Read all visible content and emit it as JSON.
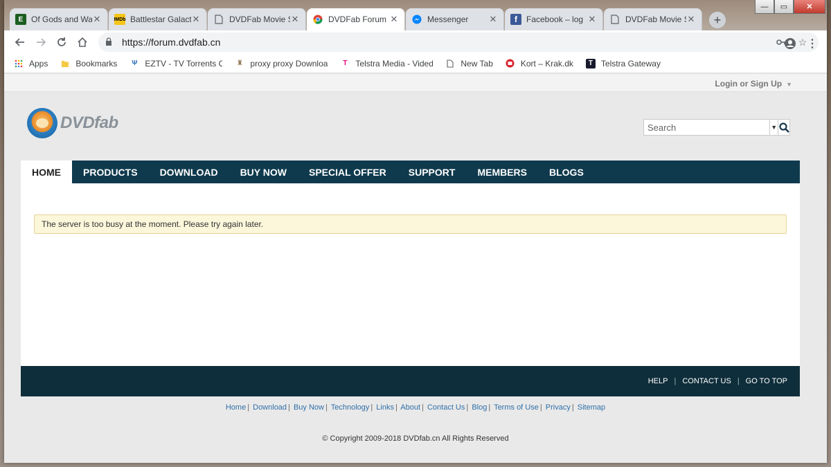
{
  "tabs": [
    {
      "label": "Of Gods and Wa",
      "icon": "book-icon",
      "color": "#1b5e20"
    },
    {
      "label": "Battlestar Galact",
      "icon": "imdb-icon",
      "color": "#f5c518"
    },
    {
      "label": "DVDFab Movie S",
      "icon": "page-icon",
      "color": "#5f6368"
    },
    {
      "label": "DVDFab Forum -",
      "icon": "chrome-icon",
      "color": "#4285f4"
    },
    {
      "label": "Messenger",
      "icon": "messenger-icon",
      "color": "#0084ff"
    },
    {
      "label": "Facebook – log",
      "icon": "facebook-icon",
      "color": "#3b5998"
    },
    {
      "label": "DVDFab Movie S",
      "icon": "page-icon",
      "color": "#5f6368"
    }
  ],
  "address": {
    "url": "https://forum.dvdfab.cn"
  },
  "bookmarks": [
    {
      "label": "Apps",
      "icon": "apps-icon"
    },
    {
      "label": "Bookmarks",
      "icon": "folder-icon"
    },
    {
      "label": "EZTV - TV Torrents O",
      "icon": "eztv-icon"
    },
    {
      "label": "proxy proxy Downloa",
      "icon": "proxy-icon"
    },
    {
      "label": "Telstra Media - Vided",
      "icon": "telstra-icon"
    },
    {
      "label": "New Tab",
      "icon": "page-icon"
    },
    {
      "label": "Kort – Krak.dk",
      "icon": "krak-icon"
    },
    {
      "label": "Telstra Gateway",
      "icon": "telstra-gateway-icon"
    }
  ],
  "site": {
    "login": "Login or Sign Up",
    "logo_text": "DVDfab",
    "search_placeholder": "Search",
    "nav": [
      "HOME",
      "PRODUCTS",
      "DOWNLOAD",
      "BUY NOW",
      "SPECIAL OFFER",
      "SUPPORT",
      "MEMBERS",
      "BLOGS"
    ],
    "notice": "The server is too busy at the moment. Please try again later.",
    "footer_bar": [
      "HELP",
      "CONTACT US",
      "GO TO TOP"
    ],
    "footer_links": [
      "Home",
      "Download",
      "Buy Now",
      "Technology",
      "Links",
      "About",
      "Contact Us",
      "Blog",
      "Terms of Use",
      "Privacy",
      "Sitemap"
    ],
    "copyright": "© Copyright 2009-2018 DVDfab.cn All Rights Reserved"
  },
  "colors": {
    "nav_bg": "#0f3a4d",
    "footer_bg": "#0f2e3b",
    "notice_bg": "#fcf6da",
    "link": "#2f6fa8"
  }
}
